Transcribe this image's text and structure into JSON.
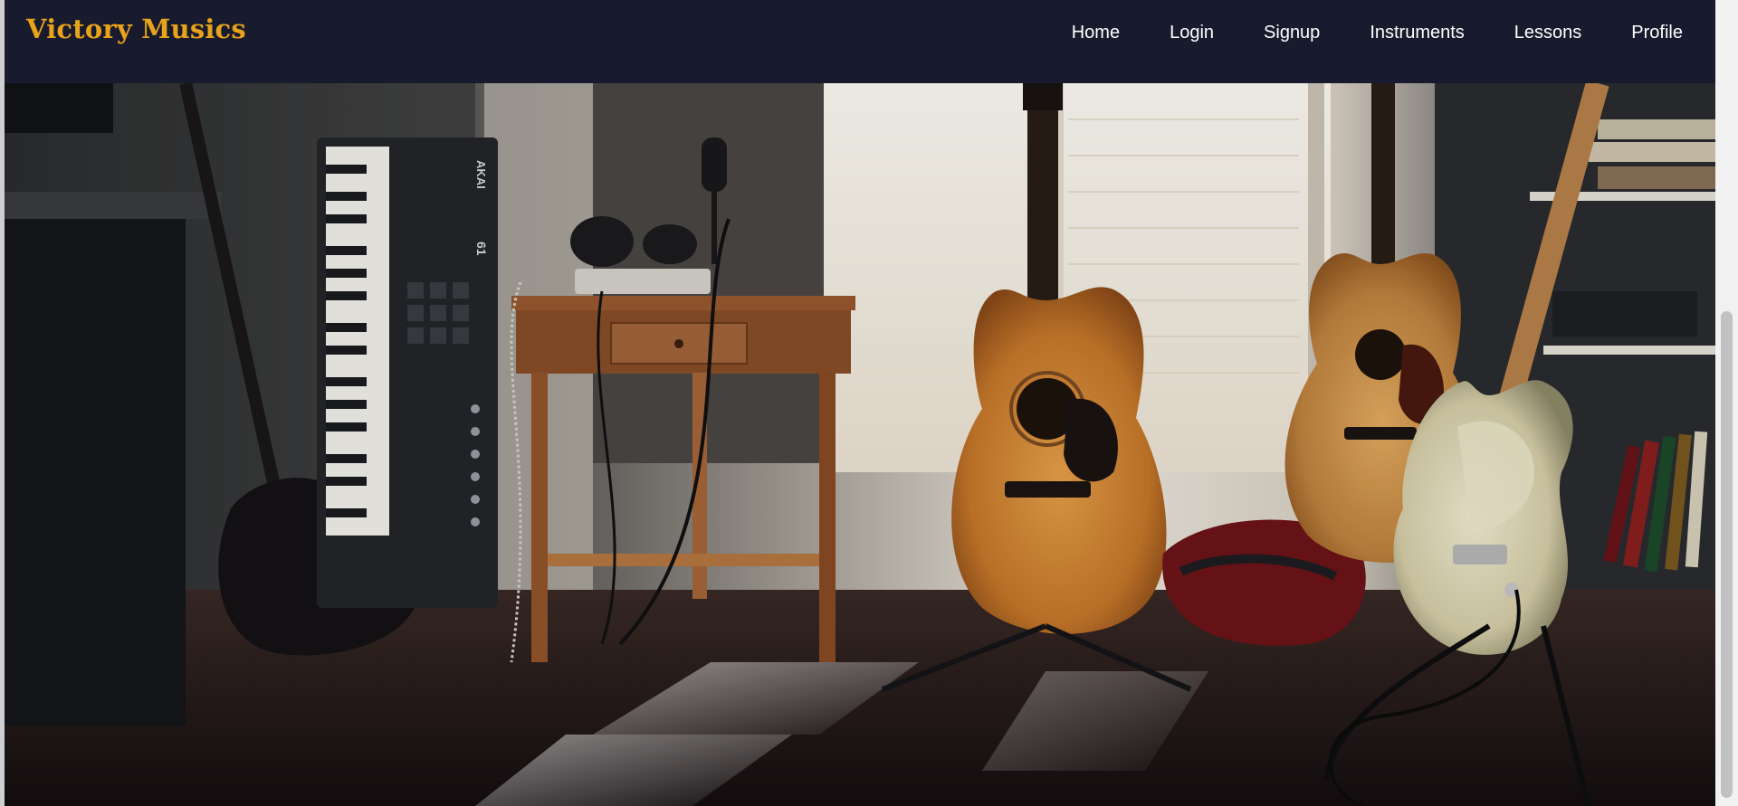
{
  "navbar": {
    "brand": "Victory Musics",
    "links": [
      {
        "label": "Home"
      },
      {
        "label": "Login"
      },
      {
        "label": "Signup"
      },
      {
        "label": "Instruments"
      },
      {
        "label": "Lessons"
      },
      {
        "label": "Profile"
      }
    ]
  },
  "hero": {
    "keyboard_brand": "AKAI",
    "keyboard_model": "61"
  },
  "colors": {
    "navbar_bg": "#181a2e",
    "brand_accent": "#e8a31a",
    "link_text": "#ffffff"
  }
}
